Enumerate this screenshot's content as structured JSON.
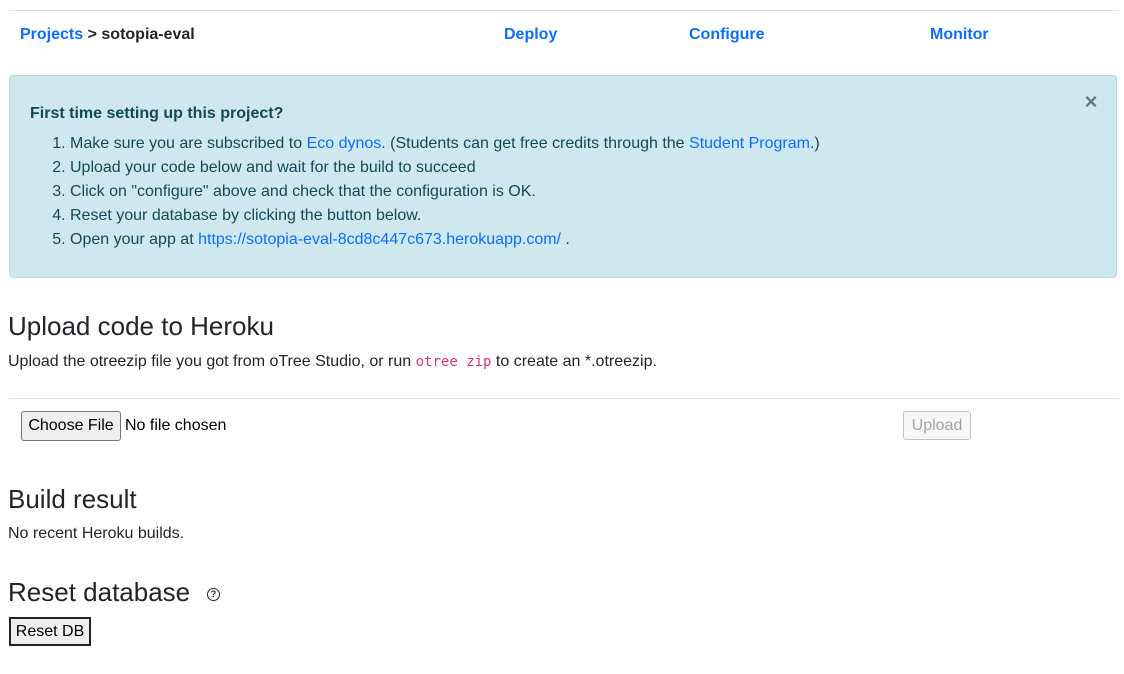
{
  "nav": {
    "breadcrumb_link": "Projects",
    "breadcrumb_sep": ">",
    "project_name": "sotopia-eval",
    "tabs": [
      "Deploy",
      "Configure",
      "Monitor"
    ]
  },
  "alert": {
    "heading": "First time setting up this project?",
    "close_symbol": "×",
    "step1_pre": "Make sure you are subscribed to ",
    "step1_link1": "Eco dynos",
    "step1_mid": ". (Students can get free credits through the ",
    "step1_link2": "Student Program",
    "step1_post": ".)",
    "step2": "Upload your code below and wait for the build to succeed",
    "step3": "Click on \"configure\" above and check that the configuration is OK.",
    "step4": "Reset your database by clicking the button below.",
    "step5_pre": "Open your app at ",
    "step5_link": "https://sotopia-eval-8cd8c447c673.herokuapp.com/",
    "step5_post": " ."
  },
  "upload": {
    "title": "Upload code to Heroku",
    "desc_pre": "Upload the otreezip file you got from oTree Studio, or run ",
    "desc_code": "otree zip",
    "desc_post": " to create an *.otreezip.",
    "choose_file_label": "Choose File",
    "file_status": "No file chosen",
    "upload_label": "Upload"
  },
  "build": {
    "title": "Build result",
    "message": "No recent Heroku builds."
  },
  "reset": {
    "title": "Reset database",
    "help_symbol": "?",
    "button_label": "Reset DB"
  }
}
